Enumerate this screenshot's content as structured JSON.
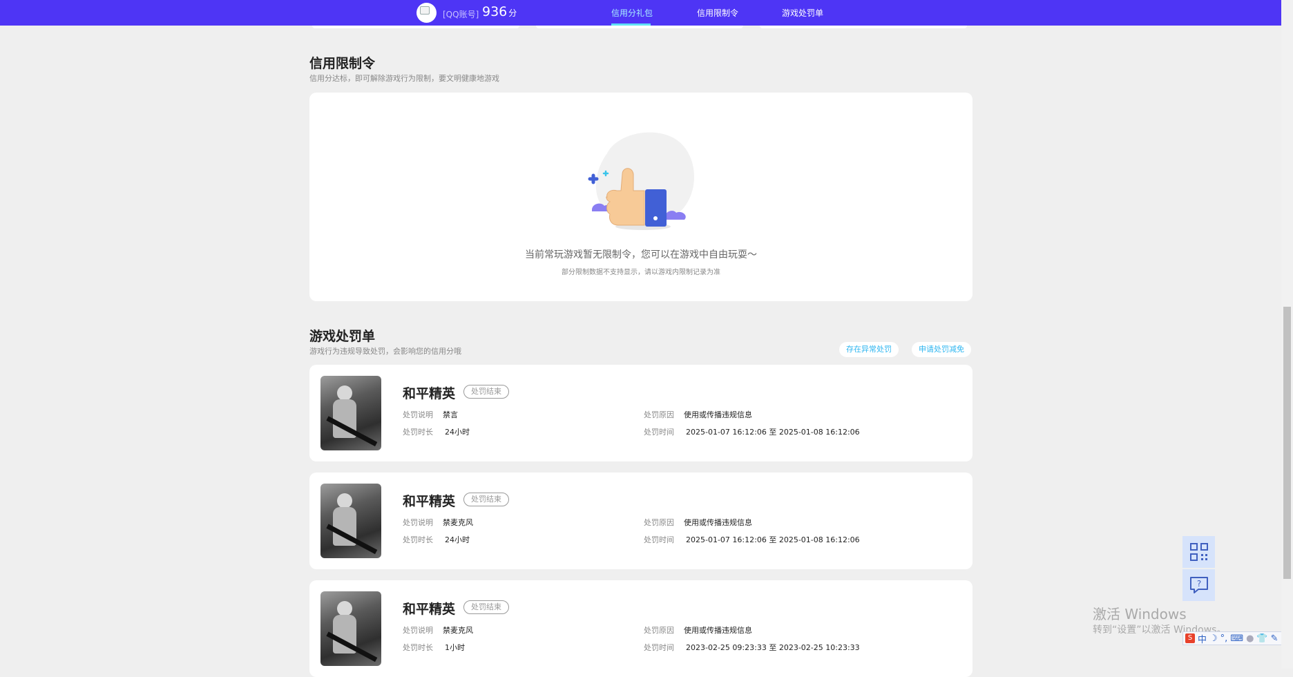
{
  "header": {
    "qq_label": "[QQ账号]",
    "score": "936",
    "score_unit": "分",
    "nav": [
      {
        "label": "信用分礼包",
        "active": true
      },
      {
        "label": "信用限制令",
        "active": false
      },
      {
        "label": "游戏处罚单",
        "active": false
      }
    ]
  },
  "restriction": {
    "title": "信用限制令",
    "subtitle": "信用分达标，即可解除游戏行为限制，要文明健康地游戏",
    "empty_message": "当前常玩游戏暂无限制令，您可以在游戏中自由玩耍～",
    "empty_note": "部分限制数据不支持显示，请以游戏内限制记录为准"
  },
  "penalty": {
    "title": "游戏处罚单",
    "subtitle": "游戏行为违规导致处罚，会影响您的信用分哦",
    "abnormal_button": "存在异常处罚",
    "appeal_button": "申请处罚减免",
    "labels": {
      "desc": "处罚说明",
      "duration": "处罚时长",
      "reason": "处罚原因",
      "time": "处罚时间",
      "to": "至"
    },
    "items": [
      {
        "game": "和平精英",
        "status": "处罚结束",
        "desc": "禁言",
        "duration": "24小时",
        "reason": "使用或传播违规信息",
        "start": "2025-01-07 16:12:06",
        "end": "2025-01-08 16:12:06"
      },
      {
        "game": "和平精英",
        "status": "处罚结束",
        "desc": "禁麦克风",
        "duration": "24小时",
        "reason": "使用或传播违规信息",
        "start": "2025-01-07 16:12:06",
        "end": "2025-01-08 16:12:06"
      },
      {
        "game": "和平精英",
        "status": "处罚结束",
        "desc": "禁麦克风",
        "duration": "1小时",
        "reason": "使用或传播违规信息",
        "start": "2023-02-25 09:23:33",
        "end": "2023-02-25 10:23:33"
      }
    ]
  },
  "watermark": {
    "line1": "激活 Windows",
    "line2": "转到“设置”以激活 Windows。"
  },
  "ime": {
    "mode": "中"
  },
  "colors": {
    "header_bg": "#4e35f5",
    "nav_active": "#a9f0ff",
    "accent_link": "#2fb6f0",
    "page_bg": "#efefef"
  }
}
